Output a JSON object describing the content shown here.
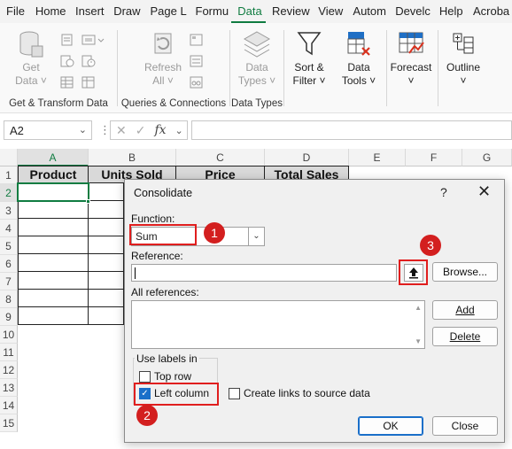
{
  "menu": {
    "tabs": [
      "File",
      "Home",
      "Insert",
      "Draw",
      "Page L",
      "Formu",
      "Data",
      "Review",
      "View",
      "Autom",
      "Develc",
      "Help",
      "Acroba"
    ],
    "active_tab": "Data"
  },
  "ribbon": {
    "get_data": "Get\nData",
    "get_data_l1": "Get",
    "get_data_l2": "Data ˅",
    "group_get_transform": "Get & Transform Data",
    "refresh_l1": "Refresh",
    "refresh_l2": "All ˅",
    "group_queries": "Queries & Connections",
    "data_types_l1": "Data",
    "data_types_l2": "Types ˅",
    "group_data_types": "Data Types",
    "sort_l1": "Sort &",
    "sort_l2": "Filter ˅",
    "data_tools_l1": "Data",
    "data_tools_l2": "Tools ˅",
    "forecast": "Forecast",
    "forecast_dd": "˅",
    "outline": "Outline",
    "outline_dd": "˅"
  },
  "formula_bar": {
    "name_box": "A2",
    "name_box_dd": "⌄",
    "dots": "⋮",
    "cancel_icon": "✕",
    "enter_icon": "✓",
    "fx": "fx",
    "fx_dd": "⌄",
    "value": ""
  },
  "sheet": {
    "columns": [
      "A",
      "B",
      "C",
      "D",
      "E",
      "F",
      "G"
    ],
    "rows": [
      "1",
      "2",
      "3",
      "4",
      "5",
      "6",
      "7",
      "8",
      "9",
      "10",
      "11",
      "12",
      "13",
      "14",
      "15"
    ],
    "headers": [
      "Product",
      "Units Sold",
      "Price",
      "Total Sales"
    ]
  },
  "dialog": {
    "title": "Consolidate",
    "help": "?",
    "close": "✕",
    "function_label": "Function:",
    "function_value": "Sum",
    "function_arrow": "⌄",
    "reference_label": "Reference:",
    "reference_value": "",
    "collapse_icon": "🡅",
    "browse": "Browse...",
    "all_refs_label": "All references:",
    "scroll_up": "▲",
    "scroll_down": "▼",
    "add": "Add",
    "delete": "Delete",
    "use_labels": "Use labels in",
    "top_row": "Top row",
    "left_column": "Left column",
    "left_column_check": "✓",
    "create_links": "Create links to source data",
    "ok": "OK",
    "close_btn": "Close"
  },
  "annotations": {
    "badge1": "1",
    "badge2": "2",
    "badge3": "3"
  },
  "colors": {
    "excel_green": "#107c41",
    "annotation_red": "#d31f1f",
    "dialog_bg": "#f0f0f0"
  }
}
